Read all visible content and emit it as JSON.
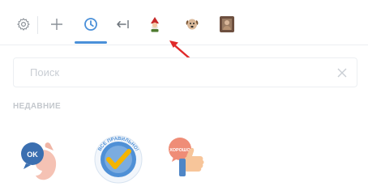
{
  "tabs": [
    {
      "name": "settings",
      "icon": "gear-icon"
    },
    {
      "name": "add",
      "icon": "plus-icon"
    },
    {
      "name": "recent",
      "icon": "clock-icon",
      "active": true
    },
    {
      "name": "back",
      "icon": "arrow-left-icon"
    },
    {
      "name": "sticker-pack-1",
      "icon": "sticker-gnome-thumbnail"
    },
    {
      "name": "sticker-pack-2",
      "icon": "sticker-dog-thumbnail"
    },
    {
      "name": "sticker-pack-3",
      "icon": "sticker-photo-thumbnail"
    }
  ],
  "colors": {
    "accent": "#4a90d9",
    "annotation_arrow": "#e02a2a"
  },
  "search": {
    "placeholder": "Поиск",
    "value": ""
  },
  "recent": {
    "title": "НЕДАВНИЕ",
    "stickers": [
      {
        "name": "sticker-bubble-hand",
        "badge": "OK"
      },
      {
        "name": "sticker-check-badge",
        "badge": "ВСЕ ПРАВИЛЬНО!"
      },
      {
        "name": "sticker-thumbs-up",
        "badge": "ХОРОШО"
      }
    ]
  }
}
